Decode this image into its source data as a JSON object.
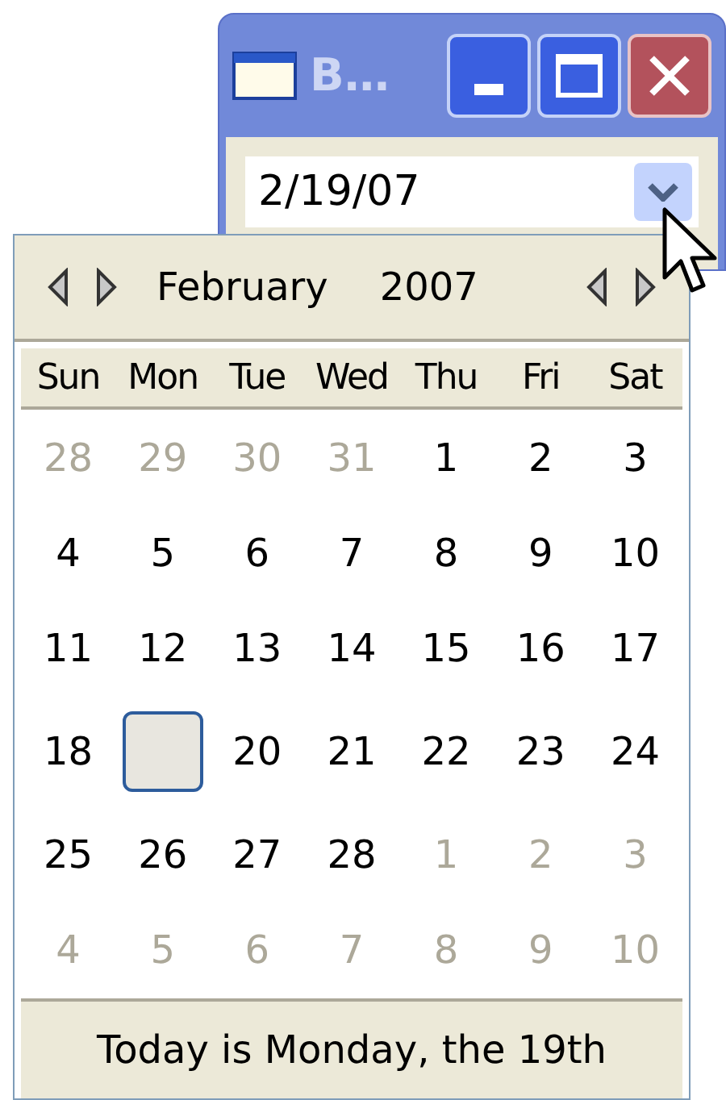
{
  "window": {
    "title": "B…"
  },
  "date_field": {
    "value": "2/19/07"
  },
  "calendar": {
    "month": "February",
    "year": "2007",
    "weekdays": [
      "Sun",
      "Mon",
      "Tue",
      "Wed",
      "Thu",
      "Fri",
      "Sat"
    ],
    "days": [
      {
        "label": "28",
        "in_month": false,
        "selected": false
      },
      {
        "label": "29",
        "in_month": false,
        "selected": false
      },
      {
        "label": "30",
        "in_month": false,
        "selected": false
      },
      {
        "label": "31",
        "in_month": false,
        "selected": false
      },
      {
        "label": "1",
        "in_month": true,
        "selected": false
      },
      {
        "label": "2",
        "in_month": true,
        "selected": false
      },
      {
        "label": "3",
        "in_month": true,
        "selected": false
      },
      {
        "label": "4",
        "in_month": true,
        "selected": false
      },
      {
        "label": "5",
        "in_month": true,
        "selected": false
      },
      {
        "label": "6",
        "in_month": true,
        "selected": false
      },
      {
        "label": "7",
        "in_month": true,
        "selected": false
      },
      {
        "label": "8",
        "in_month": true,
        "selected": false
      },
      {
        "label": "9",
        "in_month": true,
        "selected": false
      },
      {
        "label": "10",
        "in_month": true,
        "selected": false
      },
      {
        "label": "11",
        "in_month": true,
        "selected": false
      },
      {
        "label": "12",
        "in_month": true,
        "selected": false
      },
      {
        "label": "13",
        "in_month": true,
        "selected": false
      },
      {
        "label": "14",
        "in_month": true,
        "selected": false
      },
      {
        "label": "15",
        "in_month": true,
        "selected": false
      },
      {
        "label": "16",
        "in_month": true,
        "selected": false
      },
      {
        "label": "17",
        "in_month": true,
        "selected": false
      },
      {
        "label": "18",
        "in_month": true,
        "selected": false
      },
      {
        "in_month": true,
        "selected": true
      },
      {
        "label": "20",
        "in_month": true,
        "selected": false
      },
      {
        "label": "21",
        "in_month": true,
        "selected": false
      },
      {
        "label": "22",
        "in_month": true,
        "selected": false
      },
      {
        "label": "23",
        "in_month": true,
        "selected": false
      },
      {
        "label": "24",
        "in_month": true,
        "selected": false
      },
      {
        "label": "25",
        "in_month": true,
        "selected": false
      },
      {
        "label": "26",
        "in_month": true,
        "selected": false
      },
      {
        "label": "27",
        "in_month": true,
        "selected": false
      },
      {
        "label": "28",
        "in_month": true,
        "selected": false
      },
      {
        "label": "1",
        "in_month": false,
        "selected": false
      },
      {
        "label": "2",
        "in_month": false,
        "selected": false
      },
      {
        "label": "3",
        "in_month": false,
        "selected": false
      },
      {
        "label": "4",
        "in_month": false,
        "selected": false
      },
      {
        "label": "5",
        "in_month": false,
        "selected": false
      },
      {
        "label": "6",
        "in_month": false,
        "selected": false
      },
      {
        "label": "7",
        "in_month": false,
        "selected": false
      },
      {
        "label": "8",
        "in_month": false,
        "selected": false
      },
      {
        "label": "9",
        "in_month": false,
        "selected": false
      },
      {
        "label": "10",
        "in_month": false,
        "selected": false
      }
    ],
    "footer": "Today is Monday, the 19th"
  }
}
